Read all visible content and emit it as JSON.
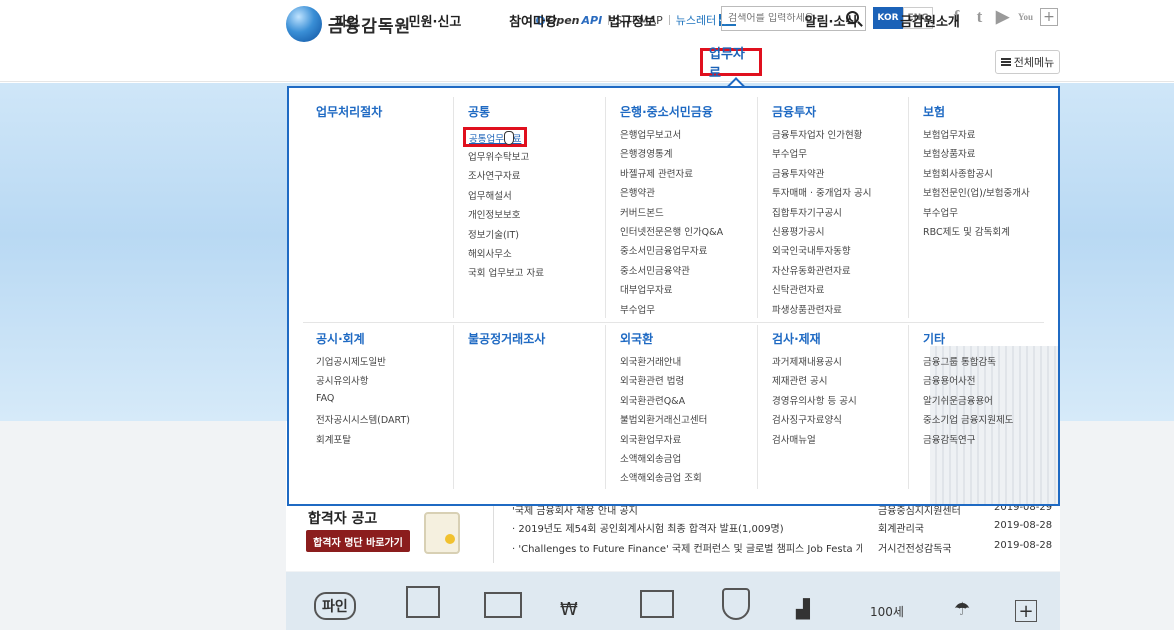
{
  "header": {
    "logo_text": "금융감독원",
    "openapi_open": "Open",
    "openapi_api": "API",
    "sitemap": "SITEMAP",
    "newsletter": "뉴스레터",
    "search_placeholder": "검색어를 입력하세요",
    "lang_kor": "KOR",
    "lang_eng": "ENG",
    "social": [
      "f",
      "t",
      "▶",
      "You"
    ]
  },
  "gnb": {
    "items": [
      {
        "label": "파인"
      },
      {
        "label": "민원·신고"
      },
      {
        "label": "참여마당"
      },
      {
        "label": "법규정보"
      },
      {
        "label": "업무자료"
      },
      {
        "label": "알림·소식"
      },
      {
        "label": "금감원소개"
      }
    ],
    "all_menu": "전체메뉴"
  },
  "mega": {
    "top": [
      {
        "title": "업무처리절차",
        "items": []
      },
      {
        "title": "공통",
        "items": [
          "공통업무자료",
          "업무위수탁보고",
          "조사연구자료",
          "업무해설서",
          "개인정보보호",
          "정보기술(IT)",
          "해외사무소",
          "국회 업무보고 자료"
        ]
      },
      {
        "title": "은행·중소서민금융",
        "items": [
          "은행업무보고서",
          "은행경영통계",
          "바젤규제 관련자료",
          "은행약관",
          "커버드본드",
          "인터넷전문은행 인가Q&A",
          "중소서민금융업무자료",
          "중소서민금융약관",
          "대부업무자료",
          "부수업무"
        ]
      },
      {
        "title": "금융투자",
        "items": [
          "금융투자업자 인가현황",
          "부수업무",
          "금융투자약관",
          "투자매매 · 중개업자 공시",
          "집합투자기구공시",
          "신용평가공시",
          "외국인국내투자동향",
          "자산유동화관련자료",
          "신탁관련자료",
          "파생상품관련자료"
        ]
      },
      {
        "title": "보험",
        "items": [
          "보험업무자료",
          "보험상품자료",
          "보험회사종합공시",
          "보험전문인(업)/보험중개사",
          "부수업무",
          "RBC제도 및 감독회계"
        ]
      }
    ],
    "bottom": [
      {
        "title": "공시·회계",
        "items": [
          "기업공시제도일반",
          "공시유의사항",
          "FAQ",
          "전자공시시스템(DART)",
          "회계포탈"
        ]
      },
      {
        "title": "불공정거래조사",
        "items": []
      },
      {
        "title": "외국환",
        "items": [
          "외국환거래안내",
          "외국환관련 법령",
          "외국환관련Q&A",
          "불법외환거래신고센터",
          "외국환업무자료",
          "소액해외송금업",
          "소액해외송금업 조회"
        ]
      },
      {
        "title": "검사·제재",
        "items": [
          "과거제재내용공시",
          "제재관련 공시",
          "경영유의사항 등 공시",
          "검사징구자료양식",
          "검사매뉴얼"
        ]
      },
      {
        "title": "기타",
        "items": [
          "금융그룹 통합감독",
          "금융용어사전",
          "알기쉬운금융용어",
          "중소기업 금융지원제도",
          "금융감독연구"
        ]
      }
    ]
  },
  "pass": {
    "title": "합격자 공고",
    "button": "합격자 명단 바로가기"
  },
  "news": [
    {
      "title": "'국제 금융회사 채용 안내 공지",
      "dept": "금융중심지지원센터",
      "date": "2019-08-29"
    },
    {
      "title": "· 2019년도 제54회 공인회계사시험 최종 합격자 발표(1,009명)",
      "dept": "회계관리국",
      "date": "2019-08-28"
    },
    {
      "title": "· 'Challenges to Future Finance' 국제 컨퍼런스 및 글로벌 챔피스 Job Festa 개최 ···",
      "dept": "거시건전성감독국",
      "date": "2019-08-28"
    }
  ],
  "quick": {
    "fine_label": "파인",
    "plus": "+"
  }
}
